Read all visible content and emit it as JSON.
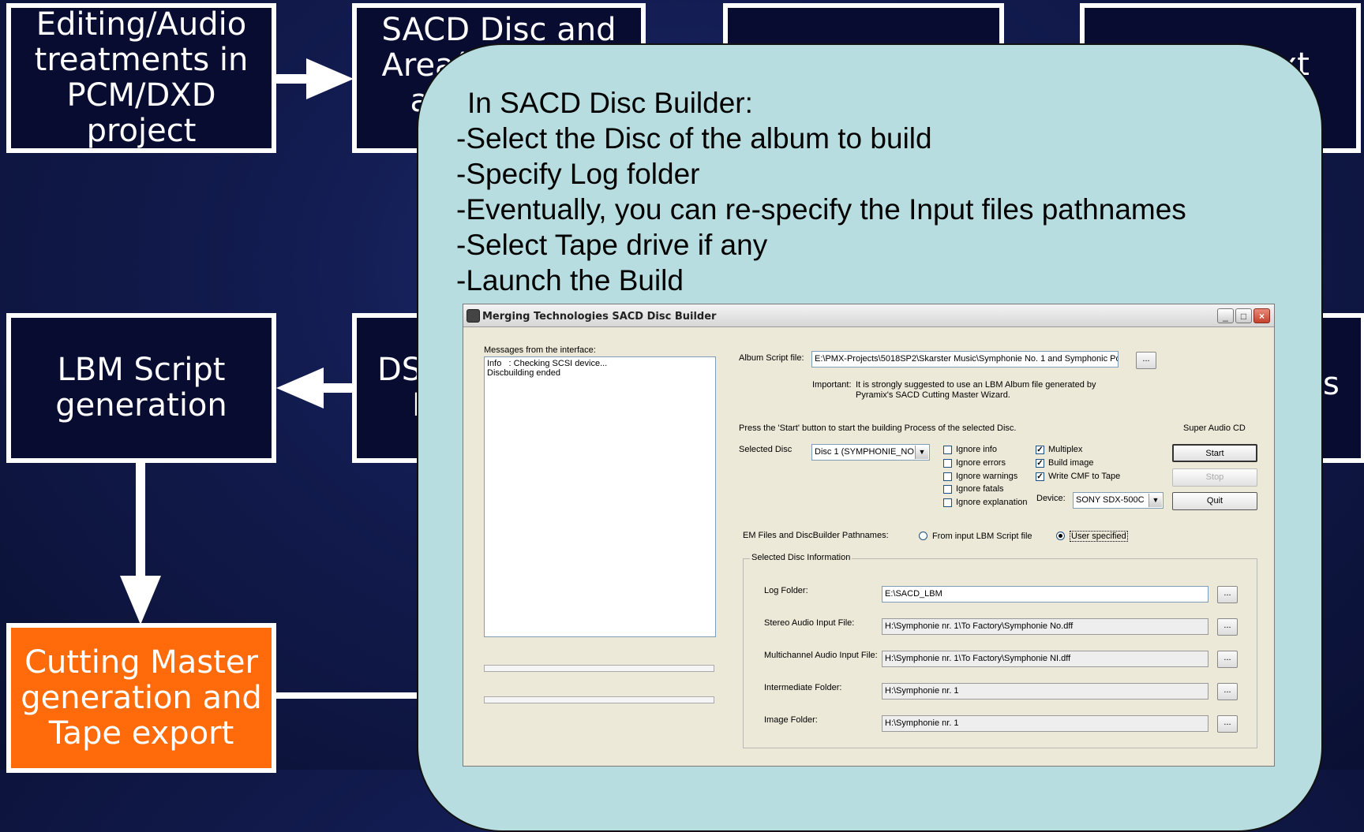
{
  "boxes": {
    "editing": [
      "Editing/Audio",
      "treatments in",
      "PCM/DXD",
      "project"
    ],
    "sacd_disc": [
      "SACD Disc and",
      "Area(s)",
      "ar"
    ],
    "text_box": "Text",
    "lbm": [
      "LBM Script",
      "generation"
    ],
    "dsd_partial": [
      "DS",
      "El"
    ],
    "right_partial": "s",
    "cutting": [
      "Cutting Master",
      "generation and",
      "Tape export"
    ]
  },
  "callout": {
    "lines": [
      "In SACD Disc Builder:",
      "-Select the Disc of the album to build",
      "-Specify Log folder",
      "-Eventually, you can re-specify the Input files pathnames",
      "-Select Tape drive if any",
      "-Launch the Build"
    ]
  },
  "window": {
    "title": "Merging Technologies SACD Disc Builder",
    "messages_label": "Messages from the interface:",
    "messages": [
      "Info   : Checking SCSI device...",
      "Discbuilding ended"
    ],
    "album_script_label": "Album Script file:",
    "album_script_value": "E:\\PMX-Projects\\5018SP2\\Skarster Music\\Symphonie No. 1 and Symphonic Po",
    "browse_label": "...",
    "important_label": "Important:",
    "important_text": [
      "It is strongly suggested to use an LBM Album file generated by",
      "Pyramix's SACD Cutting Master Wizard."
    ],
    "press_start_text": "Press the 'Start' button to start the building Process of the selected Disc.",
    "super_audio_cd": "Super Audio CD",
    "selected_disc_label": "Selected Disc",
    "selected_disc_value": "Disc 1 (SYMPHONIE_NO",
    "ignore_options": [
      {
        "label": "Ignore info",
        "checked": false
      },
      {
        "label": "Ignore errors",
        "checked": false
      },
      {
        "label": "Ignore warnings",
        "checked": false
      },
      {
        "label": "Ignore fatals",
        "checked": false
      },
      {
        "label": "Ignore explanation",
        "checked": false
      }
    ],
    "build_options": [
      {
        "label": "Multiplex",
        "checked": true
      },
      {
        "label": "Build image",
        "checked": true
      },
      {
        "label": "Write CMF to Tape",
        "checked": true
      }
    ],
    "check_mark": "✓",
    "device_label": "Device:",
    "device_value": "SONY SDX-500C",
    "start_label": "Start",
    "stop_label": "Stop",
    "quit_label": "Quit",
    "em_files_label": "EM Files and DiscBuilder Pathnames:",
    "radio_from_input": "From input LBM Script file",
    "radio_user": "User specified",
    "group_title": "Selected Disc Information",
    "folders": [
      {
        "label": "Log Folder:",
        "value": "E:\\SACD_LBM",
        "gray": false
      },
      {
        "label": "Stereo Audio Input File:",
        "value": "H:\\Symphonie nr. 1\\To Factory\\Symphonie No.dff",
        "gray": true
      },
      {
        "label": "Multichannel Audio Input File:",
        "value": "H:\\Symphonie nr. 1\\To Factory\\Symphonie NI.dff",
        "gray": true
      },
      {
        "label": "Intermediate Folder:",
        "value": "H:\\Symphonie nr. 1",
        "gray": true
      },
      {
        "label": "Image Folder:",
        "value": "H:\\Symphonie nr. 1",
        "gray": true
      }
    ]
  }
}
